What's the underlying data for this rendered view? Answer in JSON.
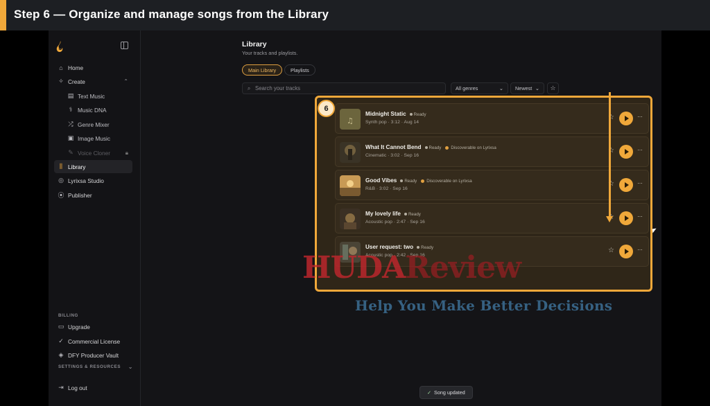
{
  "banner": {
    "title": "Step 6 — Organize and manage songs from the Library"
  },
  "sidebar": {
    "items": [
      {
        "label": "Home",
        "icon": "home-icon"
      },
      {
        "label": "Create",
        "icon": "sparkle-icon"
      },
      {
        "label": "Text Music",
        "icon": "document-icon"
      },
      {
        "label": "Music DNA",
        "icon": "dna-icon"
      },
      {
        "label": "Genre Mixer",
        "icon": "shuffle-icon"
      },
      {
        "label": "Image Music",
        "icon": "image-icon"
      },
      {
        "label": "Voice Cloner",
        "icon": "mic-icon"
      },
      {
        "label": "Library",
        "icon": "library-icon"
      },
      {
        "label": "Lyrixsa Studio",
        "icon": "studio-icon"
      },
      {
        "label": "Publisher",
        "icon": "broadcast-icon"
      }
    ],
    "billing_label": "BILLING",
    "billing_items": [
      {
        "label": "Upgrade",
        "icon": "card-icon"
      },
      {
        "label": "Commercial License",
        "icon": "check-circle-icon"
      },
      {
        "label": "DFY Producer Vault",
        "icon": "box-icon"
      }
    ],
    "settings_label": "SETTINGS & RESOURCES",
    "logout": {
      "label": "Log out",
      "icon": "logout-icon"
    }
  },
  "main": {
    "title": "Library",
    "subtitle": "Your tracks and playlists.",
    "tabs": [
      {
        "label": "Main Library"
      },
      {
        "label": "Playlists"
      }
    ],
    "search": {
      "placeholder": "Search your tracks"
    },
    "genre_select": "All genres",
    "sort_select": "Newest",
    "step_badge": "6",
    "tracks": [
      {
        "title": "Midnight Static",
        "status": "Ready",
        "discover": "",
        "meta": "Synth pop · 3:12 · Aug 14"
      },
      {
        "title": "What It Cannot Bend",
        "status": "Ready",
        "discover": "Discoverable on Lyrixsa",
        "meta": "Cinematic · 3:02 · Sep 16"
      },
      {
        "title": "Good Vibes",
        "status": "Ready",
        "discover": "Discoverable on Lyrixsa",
        "meta": "R&B · 3:02 · Sep 16"
      },
      {
        "title": "My lovely life",
        "status": "Ready",
        "discover": "",
        "meta": "Acoustic pop · 2:47 · Sep 16"
      },
      {
        "title": "User request: two",
        "status": "Ready",
        "discover": "",
        "meta": "Acoustic pop · 2:42 · Sep 16"
      }
    ],
    "toast": "Song updated"
  },
  "watermark": {
    "brand": "HUDA",
    "brand2": "Review",
    "tagline": "Help You Make Better Decisions"
  },
  "colors": {
    "accent": "#f0a83a",
    "background": "#141417",
    "watermark_red": "#c0272d",
    "watermark_blue": "#3a6a8e"
  }
}
